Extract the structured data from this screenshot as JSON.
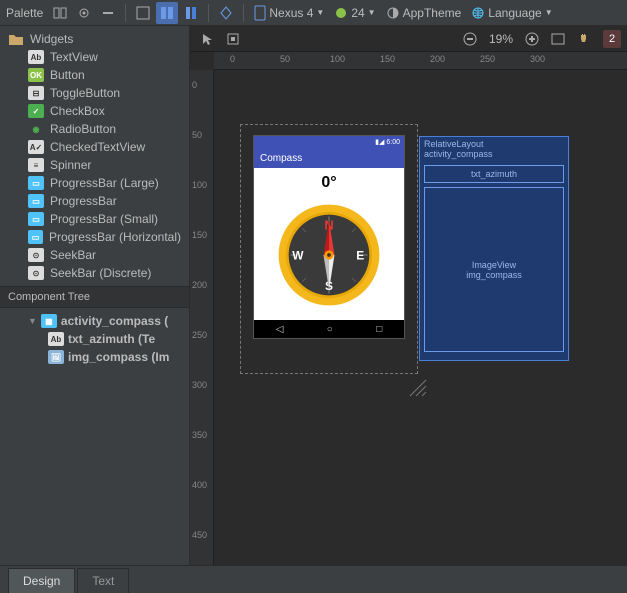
{
  "toolbar": {
    "palette_label": "Palette",
    "device": "Nexus 4",
    "api": "24",
    "theme": "AppTheme",
    "language": "Language"
  },
  "design_toolbar": {
    "zoom": "19%",
    "warnings": "2"
  },
  "ruler_h": [
    "0",
    "50",
    "100",
    "150",
    "200",
    "250",
    "300"
  ],
  "ruler_v": [
    "0",
    "50",
    "100",
    "150",
    "200",
    "250",
    "300",
    "350",
    "400",
    "450"
  ],
  "palette": {
    "folder": "Widgets",
    "items": [
      {
        "label": "TextView",
        "icon": "Ab",
        "bg": "#ddd",
        "fg": "#333"
      },
      {
        "label": "Button",
        "icon": "OK",
        "bg": "#8bc34a",
        "fg": "#fff"
      },
      {
        "label": "ToggleButton",
        "icon": "⊟",
        "bg": "#ddd",
        "fg": "#333"
      },
      {
        "label": "CheckBox",
        "icon": "✓",
        "bg": "#4caf50",
        "fg": "#fff"
      },
      {
        "label": "RadioButton",
        "icon": "◉",
        "bg": "transparent",
        "fg": "#4caf50"
      },
      {
        "label": "CheckedTextView",
        "icon": "A✓",
        "bg": "#ddd",
        "fg": "#333"
      },
      {
        "label": "Spinner",
        "icon": "≡",
        "bg": "#ddd",
        "fg": "#333"
      },
      {
        "label": "ProgressBar (Large)",
        "icon": "▭",
        "bg": "#4fc3f7",
        "fg": "#fff"
      },
      {
        "label": "ProgressBar",
        "icon": "▭",
        "bg": "#4fc3f7",
        "fg": "#fff"
      },
      {
        "label": "ProgressBar (Small)",
        "icon": "▭",
        "bg": "#4fc3f7",
        "fg": "#fff"
      },
      {
        "label": "ProgressBar (Horizontal)",
        "icon": "▭",
        "bg": "#4fc3f7",
        "fg": "#fff"
      },
      {
        "label": "SeekBar",
        "icon": "⊙",
        "bg": "#ddd",
        "fg": "#333"
      },
      {
        "label": "SeekBar (Discrete)",
        "icon": "⊙",
        "bg": "#ddd",
        "fg": "#333"
      }
    ]
  },
  "component_tree": {
    "title": "Component Tree",
    "root": "activity_compass (",
    "children": [
      {
        "name": "txt_azimuth (Te",
        "icon": "Ab"
      },
      {
        "name": "img_compass (Im",
        "icon": "🖼"
      }
    ]
  },
  "preview": {
    "status_time": "6:00",
    "app_title": "Compass",
    "azimuth": "0°",
    "compass_letters": {
      "n": "N",
      "e": "E",
      "s": "S",
      "w": "W"
    }
  },
  "blueprint": {
    "root_type": "RelativeLayout",
    "root_id": "activity_compass",
    "txt_id": "txt_azimuth",
    "img_type": "ImageView",
    "img_id": "img_compass"
  },
  "tabs": {
    "design": "Design",
    "text": "Text"
  }
}
